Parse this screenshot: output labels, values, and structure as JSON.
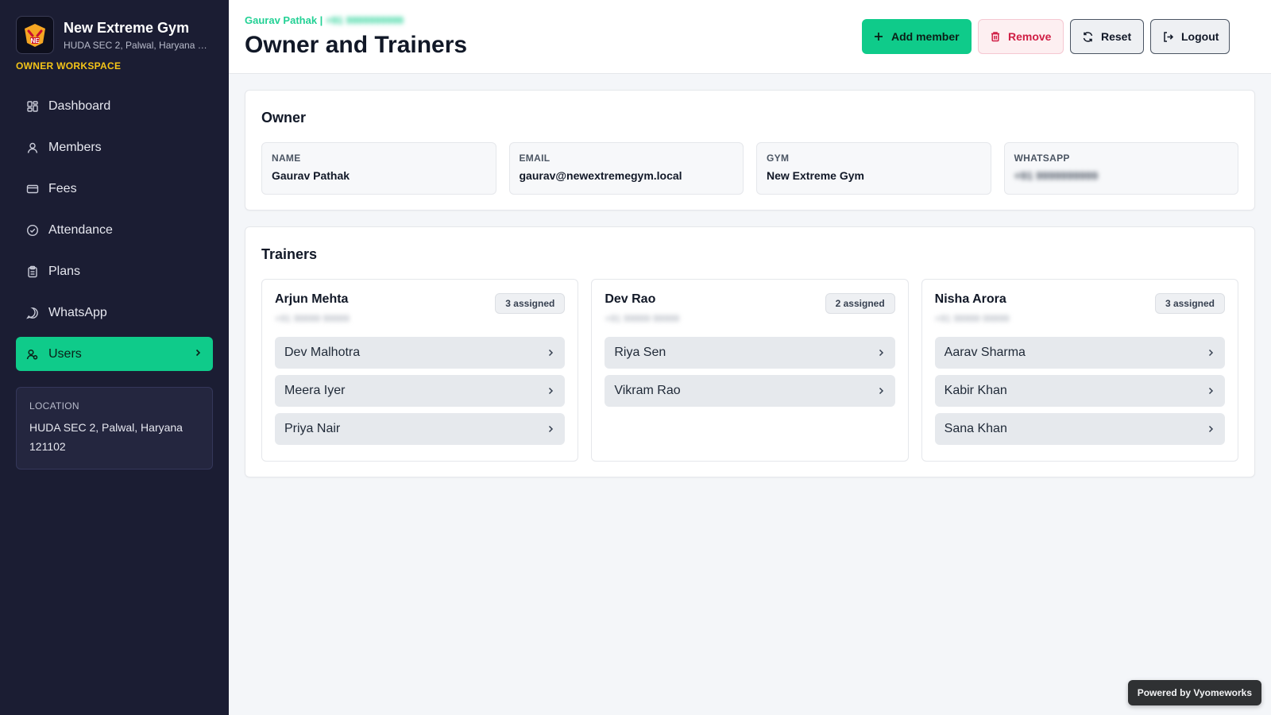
{
  "sidebar": {
    "gym_name": "New Extreme Gym",
    "gym_address": "HUDA SEC 2, Palwal, Haryana 121102",
    "logo_text": "NE",
    "workspace_label": "OWNER WORKSPACE",
    "nav": [
      {
        "label": "Dashboard",
        "icon": "dashboard-icon"
      },
      {
        "label": "Members",
        "icon": "user-icon"
      },
      {
        "label": "Fees",
        "icon": "card-icon"
      },
      {
        "label": "Attendance",
        "icon": "check-circle-icon"
      },
      {
        "label": "Plans",
        "icon": "clipboard-icon"
      },
      {
        "label": "WhatsApp",
        "icon": "chat-icon"
      },
      {
        "label": "Users",
        "icon": "users-icon",
        "active": true
      }
    ],
    "location": {
      "title": "LOCATION",
      "line1": "HUDA SEC 2, Palwal, Haryana",
      "line2": "121102"
    }
  },
  "header": {
    "user_name": "Gaurav Pathak",
    "separator": "|",
    "user_phone": "+91 9999999999",
    "title": "Owner and Trainers",
    "buttons": {
      "add": "Add member",
      "remove": "Remove",
      "reset": "Reset",
      "logout": "Logout"
    }
  },
  "owner": {
    "title": "Owner",
    "fields": [
      {
        "label": "NAME",
        "value": "Gaurav Pathak"
      },
      {
        "label": "EMAIL",
        "value": "gaurav@newextremegym.local"
      },
      {
        "label": "GYM",
        "value": "New Extreme Gym"
      },
      {
        "label": "WHATSAPP",
        "value": "+91 9999999999"
      }
    ]
  },
  "trainers": {
    "title": "Trainers",
    "list": [
      {
        "name": "Arjun Mehta",
        "phone": "+91 99999 99999",
        "badge": "3 assigned",
        "members": [
          "Dev Malhotra",
          "Meera Iyer",
          "Priya Nair"
        ]
      },
      {
        "name": "Dev Rao",
        "phone": "+91 99999 99999",
        "badge": "2 assigned",
        "members": [
          "Riya Sen",
          "Vikram Rao"
        ]
      },
      {
        "name": "Nisha Arora",
        "phone": "+91 99999 99999",
        "badge": "3 assigned",
        "members": [
          "Aarav Sharma",
          "Kabir Khan",
          "Sana Khan"
        ]
      }
    ]
  },
  "footer": {
    "powered": "Powered by Vyomeworks"
  },
  "colors": {
    "accent": "#0fcb8a",
    "sidebar_bg": "#1b1d33",
    "workspace": "#f5c518",
    "danger": "#d01e45"
  }
}
